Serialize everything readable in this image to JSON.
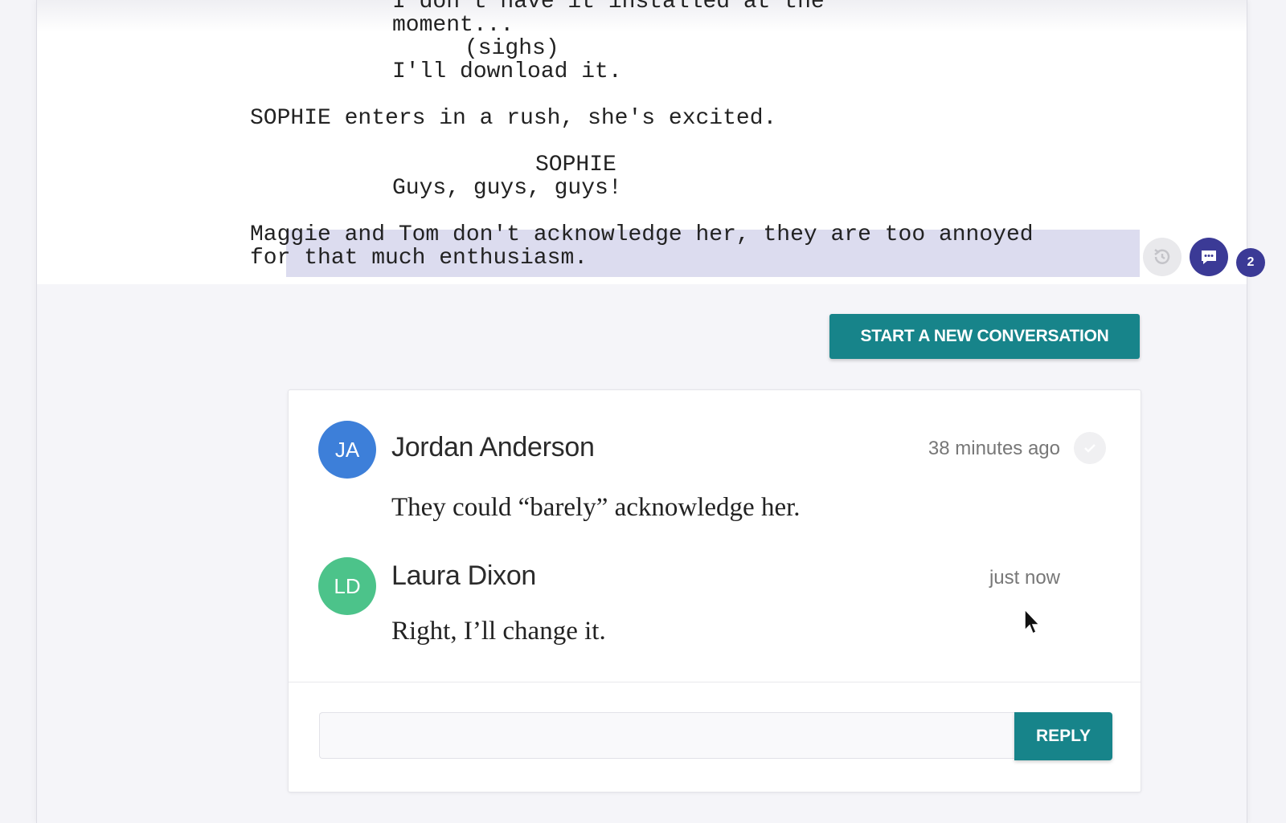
{
  "script": {
    "lines": [
      "I don't have it installed at the",
      "moment...",
      "(sighs)",
      "I'll download it.",
      "SOPHIE enters in a rush, she's excited.",
      "SOPHIE",
      "Guys, guys, guys!",
      "Maggie and Tom don't acknowledge her, they are too annoyed",
      "for that much enthusiasm."
    ]
  },
  "comments_badge": "2",
  "new_conversation_label": "START A NEW CONVERSATION",
  "conversation": {
    "messages": [
      {
        "initials": "JA",
        "author": "Jordan Anderson",
        "time": "38 minutes ago",
        "text": "They could “barely” acknowledge her.",
        "avatar_color": "#3d7fd9"
      },
      {
        "initials": "LD",
        "author": "Laura Dixon",
        "time": "just now",
        "text": "Right, I’ll change it.",
        "avatar_color": "#4cc38a"
      }
    ],
    "reply_value": "",
    "reply_label": "REPLY"
  },
  "colors": {
    "accent": "#17848a",
    "comment_icon": "#3b3a96",
    "highlight": "#dcdcef"
  }
}
